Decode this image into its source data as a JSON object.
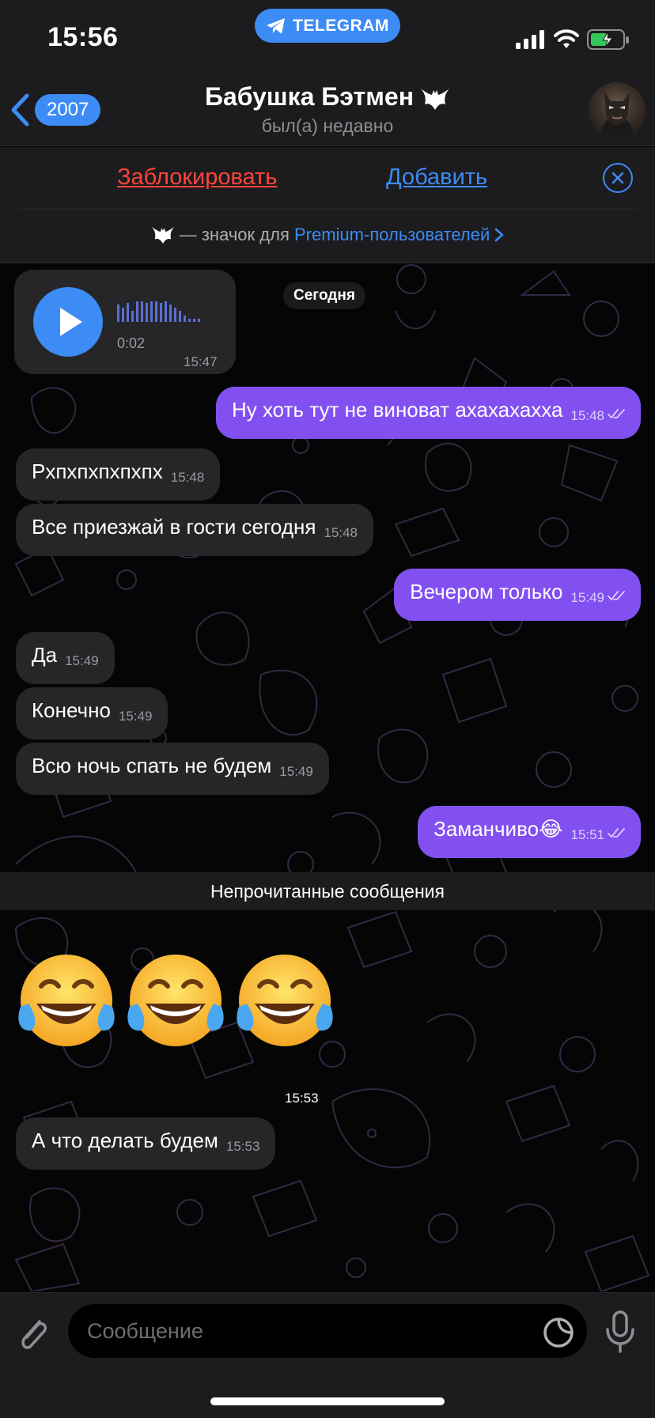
{
  "status_bar": {
    "time": "15:56",
    "app_pill": "TELEGRAM",
    "accent": "#3d8bf5"
  },
  "nav": {
    "back_count": "2007",
    "title": "Бабушка Бэтмен",
    "status": "был(а) недавно"
  },
  "panel": {
    "block_label": "Заблокировать",
    "add_label": "Добавить",
    "premium_prefix": "— значок для",
    "premium_link": "Premium-пользователей"
  },
  "chat": {
    "date_chip": "Сегодня",
    "voice": {
      "duration": "0:02",
      "time": "15:47"
    },
    "messages": [
      {
        "dir": "out",
        "text": "Ну хоть тут не виноват ахахахахха",
        "time": "15:48"
      },
      {
        "dir": "in",
        "text": "Рхпхпхпхпхпх",
        "time": "15:48"
      },
      {
        "dir": "in",
        "text": "Все приезжай в гости сегодня",
        "time": "15:48"
      },
      {
        "dir": "out",
        "text": "Вечером только",
        "time": "15:49"
      },
      {
        "dir": "in",
        "text": "Да",
        "time": "15:49"
      },
      {
        "dir": "in",
        "text": "Конечно",
        "time": "15:49"
      },
      {
        "dir": "in",
        "text": "Всю ночь спать не будем",
        "time": "15:49"
      },
      {
        "dir": "out",
        "text": "Заманчиво😂",
        "time": "15:51"
      }
    ],
    "unread_label": "Непрочитанные сообщения",
    "big_emoji": {
      "emoji": "😂😂😂",
      "time": "15:53"
    },
    "last_message": {
      "dir": "in",
      "text": "А что делать будем",
      "time": "15:53"
    }
  },
  "input": {
    "placeholder": "Сообщение"
  },
  "colors": {
    "outgoing_bubble": "#8250f0",
    "incoming_bubble": "#262628",
    "destructive": "#ff453a"
  }
}
